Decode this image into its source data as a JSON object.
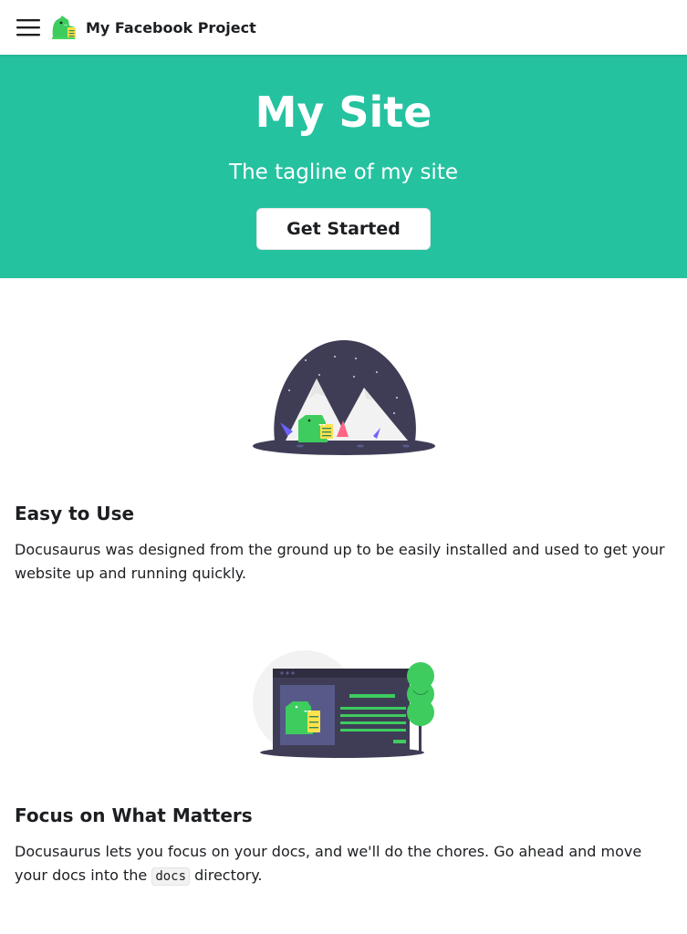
{
  "navbar": {
    "menu_icon": "hamburger-menu-icon",
    "logo_icon": "dinosaur-logo-icon",
    "title": "My Facebook Project"
  },
  "hero": {
    "title": "My Site",
    "tagline": "The tagline of my site",
    "button_label": "Get Started",
    "background_color": "#25c2a0"
  },
  "features": [
    {
      "illustration": "mountain-dinosaur-illustration",
      "title": "Easy to Use",
      "description": "Docusaurus was designed from the ground up to be easily installed and used to get your website up and running quickly."
    },
    {
      "illustration": "browser-window-dinosaur-illustration",
      "title": "Focus on What Matters",
      "description_before": "Docusaurus lets you focus on your docs, and we'll do the chores. Go ahead and move your docs into the",
      "description_code": "docs",
      "description_after": "directory."
    }
  ]
}
